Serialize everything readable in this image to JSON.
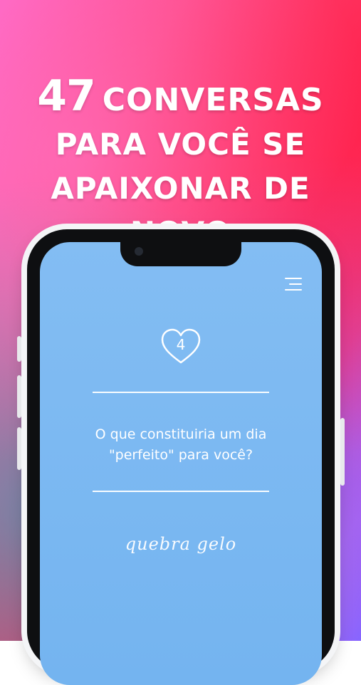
{
  "headline": {
    "number": "47",
    "line1_rest": "CONVERSAS",
    "line2": "PARA VOCÊ SE",
    "line3": "APAIXONAR DE NOVO"
  },
  "card": {
    "number": "4",
    "question": "O que constituiria um dia \"perfeito\" para você?",
    "category": "quebra gelo"
  },
  "icons": {
    "menu": "menu-icon",
    "heart": "heart-icon"
  },
  "colors": {
    "screen_bg": "#7db8f1",
    "text": "#ffffff"
  }
}
